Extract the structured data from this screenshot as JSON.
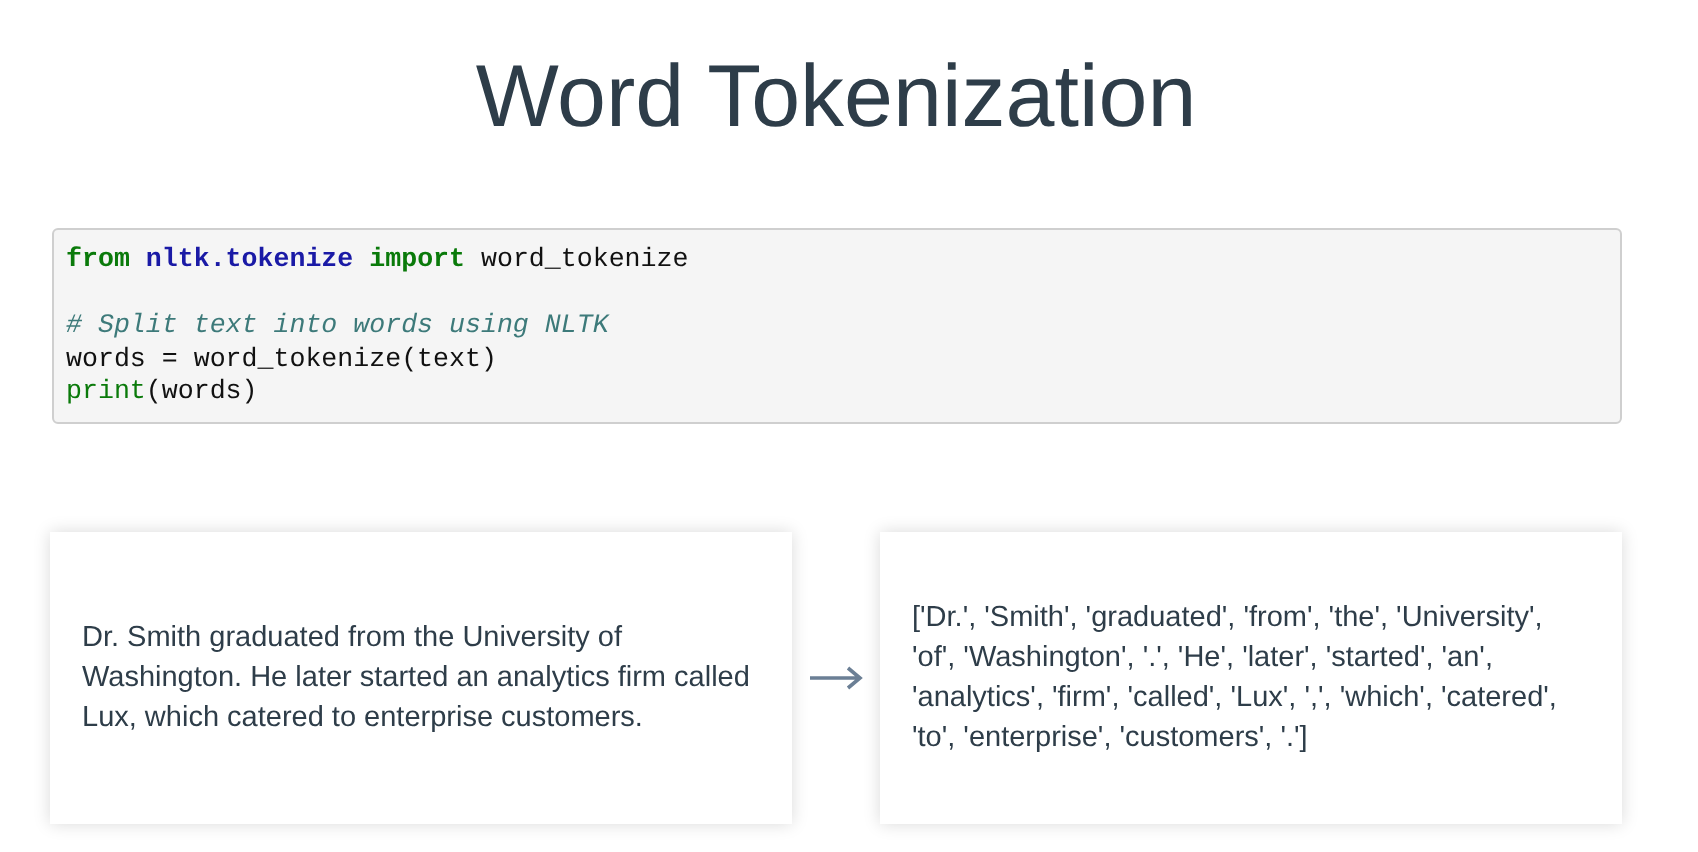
{
  "title": "Word Tokenization",
  "code": {
    "lines": [
      {
        "kind": "code",
        "tokens": [
          {
            "kind": "keyword",
            "text": "from"
          },
          {
            "kind": "module",
            "text": " nltk.tokenize "
          },
          {
            "kind": "keyword",
            "text": "import"
          },
          {
            "kind": "plain",
            "text": " word_tokenize"
          }
        ]
      },
      {
        "kind": "blank"
      },
      {
        "kind": "code",
        "tokens": [
          {
            "kind": "comment",
            "text": "# Split text into words using NLTK"
          }
        ]
      },
      {
        "kind": "code",
        "tokens": [
          {
            "kind": "plain",
            "text": "words = word_tokenize(text)"
          }
        ]
      },
      {
        "kind": "code",
        "tokens": [
          {
            "kind": "builtin",
            "text": "print"
          },
          {
            "kind": "plain",
            "text": "(words)"
          }
        ]
      }
    ]
  },
  "input_text": "Dr. Smith graduated from the University of Washington. He later started an analytics firm called Lux, which catered to enterprise customers.",
  "output_text": "['Dr.', 'Smith', 'graduated', 'from', 'the', 'University', 'of', 'Washington', '.', 'He', 'later', 'started', 'an', 'analytics', 'firm', 'called', 'Lux', ',', 'which', 'catered', 'to', 'enterprise', 'customers', '.']"
}
